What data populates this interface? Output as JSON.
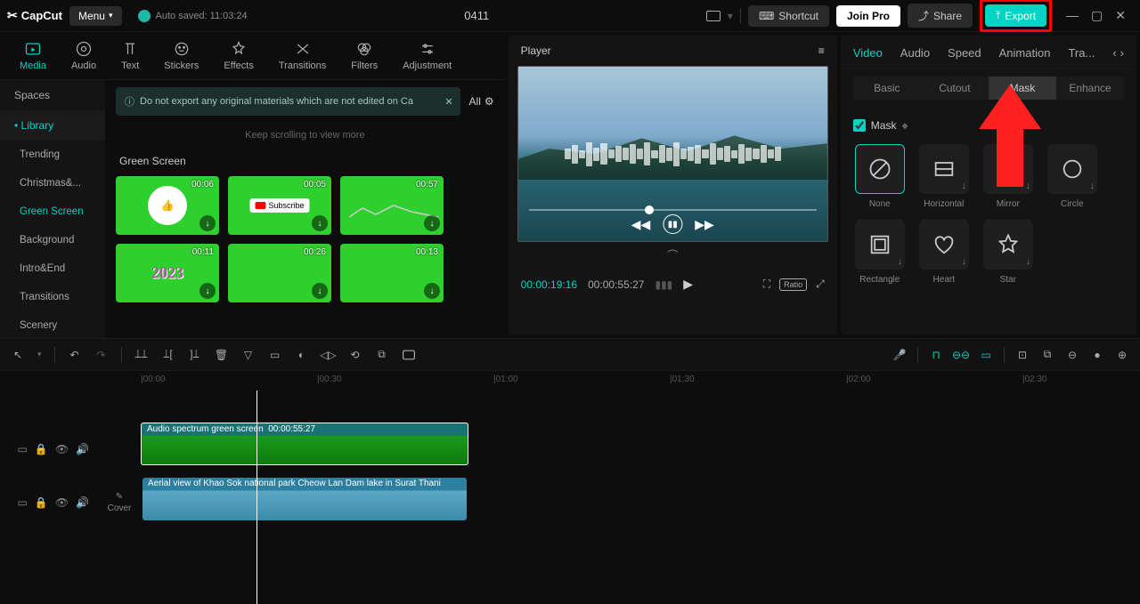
{
  "app": {
    "name": "CapCut",
    "menu": "Menu",
    "autosave": "Auto saved: 11:03:24",
    "project": "0411"
  },
  "titlebar": {
    "shortcut": "Shortcut",
    "joinpro": "Join Pro",
    "share": "Share",
    "export": "Export"
  },
  "topTabs": [
    {
      "label": "Media",
      "active": true
    },
    {
      "label": "Audio"
    },
    {
      "label": "Text"
    },
    {
      "label": "Stickers"
    },
    {
      "label": "Effects"
    },
    {
      "label": "Transitions"
    },
    {
      "label": "Filters"
    },
    {
      "label": "Adjustment"
    }
  ],
  "sidebar": {
    "spaces": "Spaces",
    "library": "Library",
    "items": [
      "Trending",
      "Christmas&...",
      "Green Screen",
      "Background",
      "Intro&End",
      "Transitions",
      "Scenery"
    ],
    "activeIndex": 2
  },
  "notice": "Do not export any original materials which are not edited on Ca",
  "allFilter": "All",
  "scrollMsg": "Keep scrolling to view more",
  "sectionTitle": "Green Screen",
  "thumbs": [
    {
      "time": "00:06",
      "type": "like"
    },
    {
      "time": "00:05",
      "type": "subscribe"
    },
    {
      "time": "00:57",
      "type": "wave"
    },
    {
      "time": "00:11",
      "type": "2023"
    },
    {
      "time": "00:26",
      "type": "plain"
    },
    {
      "time": "00:13",
      "type": "plain"
    }
  ],
  "player": {
    "title": "Player",
    "current": "00:00:19:16",
    "total": "00:00:55:27",
    "ratio": "Ratio"
  },
  "rightTabs": [
    "Video",
    "Audio",
    "Speed",
    "Animation",
    "Tra..."
  ],
  "subTabs": [
    "Basic",
    "Cutout",
    "Mask",
    "Enhance"
  ],
  "maskCheck": "Mask",
  "masks": [
    {
      "label": "None",
      "active": true
    },
    {
      "label": "Horizontal"
    },
    {
      "label": "Mirror"
    },
    {
      "label": "Circle"
    },
    {
      "label": "Rectangle"
    },
    {
      "label": "Heart"
    },
    {
      "label": "Star"
    }
  ],
  "ruler": [
    "|00:00",
    "|00:30",
    "|01:00",
    "|01:30",
    "|02:00",
    "|02:30"
  ],
  "clips": {
    "audio": {
      "title": "Audio spectrum green screen",
      "time": "00:00:55:27"
    },
    "video": {
      "title": "Aerial view of Khao Sok national park Cheow Lan Dam lake in Surat Thani"
    }
  },
  "cover": "Cover"
}
